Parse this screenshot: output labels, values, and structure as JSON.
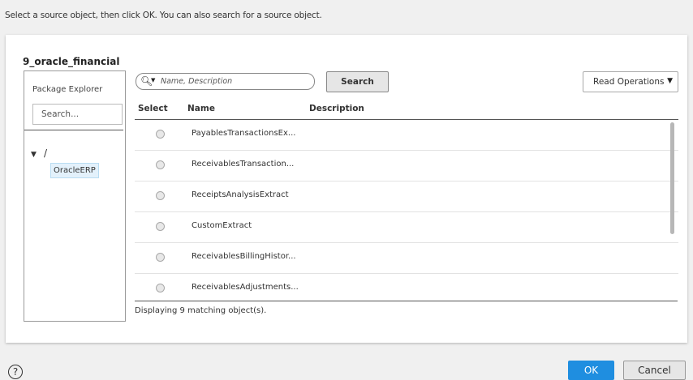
{
  "instruction": "Select a source object, then click OK. You can also search for a source object.",
  "connection_title": "9_oracle_financial",
  "explorer": {
    "label": "Package Explorer",
    "search_placeholder": "Search...",
    "tree_root": "/",
    "tree_child": "OracleERP"
  },
  "search": {
    "placeholder": "Name, Description",
    "button_label": "Search"
  },
  "operations": {
    "selected": "Read Operations"
  },
  "table": {
    "columns": [
      "Select",
      "Name",
      "Description"
    ],
    "rows": [
      {
        "name": "PayablesTransactionsEx...",
        "description": ""
      },
      {
        "name": "ReceivablesTransaction...",
        "description": ""
      },
      {
        "name": "ReceiptsAnalysisExtract",
        "description": ""
      },
      {
        "name": "CustomExtract",
        "description": ""
      },
      {
        "name": "ReceivablesBillingHistor...",
        "description": ""
      },
      {
        "name": "ReceivablesAdjustments...",
        "description": ""
      }
    ]
  },
  "footer": {
    "status": "Displaying 9 matching object(s)."
  },
  "buttons": {
    "ok": "OK",
    "cancel": "Cancel"
  },
  "icons": {
    "help": "help-icon",
    "search": "search-icon",
    "expand": "caret-down-icon"
  },
  "colors": {
    "primary": "#1f8ee0",
    "selection": "#e3f1fb"
  }
}
